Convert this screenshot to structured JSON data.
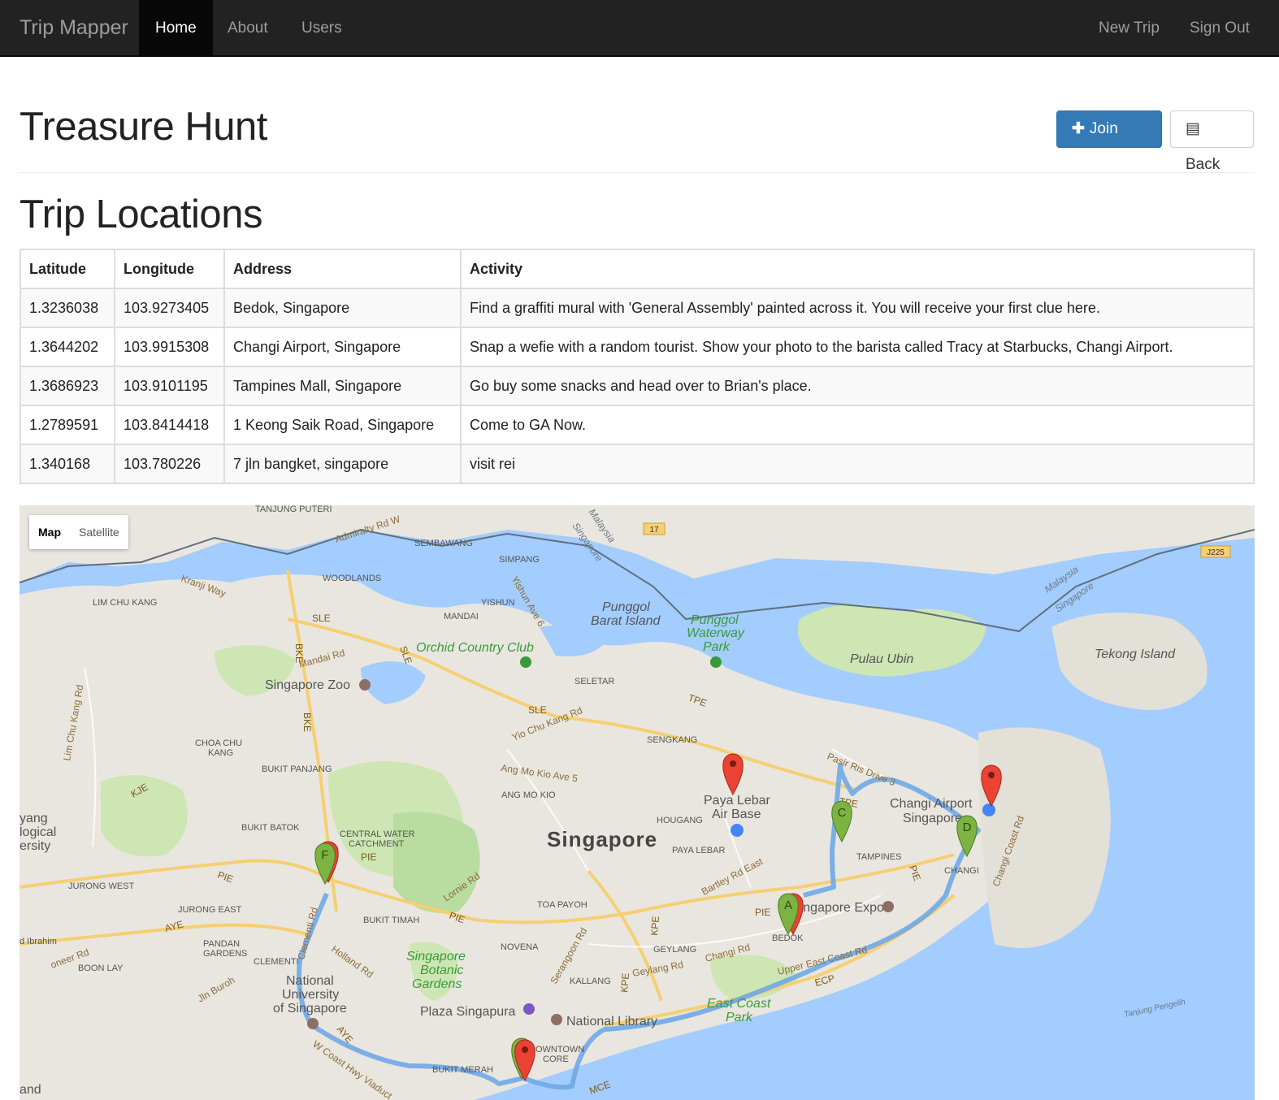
{
  "nav": {
    "brand": "Trip Mapper",
    "items": [
      {
        "label": "Home"
      },
      {
        "label": "About"
      },
      {
        "label": "Users"
      }
    ],
    "right": [
      {
        "label": "New Trip"
      },
      {
        "label": "Sign Out"
      }
    ]
  },
  "page": {
    "title": "Treasure Hunt",
    "join_label": "Join Trip",
    "back_label": "Back",
    "section_title": "Trip Locations"
  },
  "table": {
    "headers": [
      "Latitude",
      "Longitude",
      "Address",
      "Activity"
    ],
    "rows": [
      [
        "1.3236038",
        "103.9273405",
        "Bedok, Singapore",
        "Find a graffiti mural with 'General Assembly' painted across it. You will receive your first clue here."
      ],
      [
        "1.3644202",
        "103.9915308",
        "Changi Airport, Singapore",
        "Snap a wefie with a random tourist. Show your photo to the barista called Tracy at Starbucks, Changi Airport."
      ],
      [
        "1.3686923",
        "103.9101195",
        "Tampines Mall, Singapore",
        "Go buy some snacks and head over to Brian's place."
      ],
      [
        "1.2789591",
        "103.8414418",
        "1 Keong Saik Road, Singapore",
        "Come to GA Now."
      ],
      [
        "1.340168",
        "103.780226",
        "7 jln bangket, singapore",
        "visit rei"
      ]
    ]
  },
  "map": {
    "type_map": "Map",
    "type_satellite": "Satellite",
    "labels": {
      "singapore": "Singapore",
      "punggol_barat": "Punggol",
      "punggol_barat2": "Barat Island",
      "punggol_park": "Punggol",
      "punggol_park2": "Waterway",
      "punggol_park3": "Park",
      "pulau_ubin": "Pulau Ubin",
      "tekong": "Tekong Island",
      "orchid": "Orchid Country Club",
      "zoo": "Singapore Zoo",
      "changi": "Changi Airport",
      "changi2": "Singapore",
      "paya_lebar": "Paya Lebar",
      "paya_lebar2": "Air Base",
      "expo": "Singapore Expo",
      "botanic": "Singapore",
      "botanic2": "Botanic",
      "botanic3": "Gardens",
      "plaza": "Plaza Singapura",
      "library": "National Library",
      "nus": "National",
      "nus2": "University",
      "nus3": "of Singapore",
      "east_coast": "East Coast",
      "east_coast2": "Park",
      "sembawang": "SEMBAWANG",
      "simpang": "SIMPANG",
      "woodlands": "WOODLANDS",
      "yishun": "YISHUN",
      "mandai": "MANDAI",
      "lim_chu_kang": "LIM CHU KANG",
      "seletar": "SELETAR",
      "sengkang": "SENGKANG",
      "ang_mo_kio": "ANG MO KIO",
      "hougang": "HOUGANG",
      "paya_lebar_dist": "PAYA LEBAR",
      "tampines": "TAMPINES",
      "bukit_panjang": "BUKIT PANJANG",
      "bukit_batok": "BUKIT BATOK",
      "choa_chu_kang": "CHOA CHU",
      "choa_chu_kang2": "KANG",
      "central_water": "CENTRAL WATER",
      "central_water2": "CATCHMENT",
      "jurong_west": "JURONG WEST",
      "jurong_east": "JURONG EAST",
      "bukit_timah": "BUKIT TIMAH",
      "toa_payoh": "TOA PAYOH",
      "novena": "NOVENA",
      "geylang": "GEYLANG",
      "kallang": "KALLANG",
      "pandan": "PANDAN",
      "pandan2": "GARDENS",
      "clementi": "CLEMENTI",
      "boon_lay": "BOON LAY",
      "downtown": "DOWNTOWN",
      "downtown2": "CORE",
      "bukit_merah": "BUKIT MERAH",
      "changi_dist": "CHANGI",
      "bedok": "BEDOK",
      "tanjung_puteri": "TANJUNG PUTERI",
      "kranji": "Kranji Way",
      "admiralty": "Admiralty Rd W",
      "mandai_rd": "Mandai Rd",
      "yio_chu_kang": "Yio Chu Kang Rd",
      "lorong": "Lornie Rd",
      "upper_east": "Upper East Coast Rd",
      "geylang_rd": "Geylang Rd",
      "changi_rd": "Changi Rd",
      "holland": "Holland Rd",
      "serangoon": "Serangoon Rd",
      "clementi_rd": "Clementi Rd",
      "jln_buroh": "Jln Buroh",
      "w_coast": "W Coast Hwy Viaduct",
      "changi_coast": "Changi Coast Rd",
      "lim_chu_kang_rd": "Lim Chu Kang Rd",
      "bartley": "Bartley Rd East",
      "pasir_ris": "Pasir Ris Drive 3",
      "ang_mo_kio_ave": "Ang Mo Kio Ave 5",
      "yishun_ave": "Yishun Ave 6",
      "malaysia": "Malaysia",
      "singapore_border": "Singapore",
      "yang": "yang",
      "logical": "logical",
      "ersity": "ersity",
      "d_ibrahim": "d Ibrahim",
      "pioneer": "oneer Rd",
      "and": "and",
      "tanjung_pengelih": "Tanjung Pengelih",
      "sle": "SLE",
      "bke": "BKE",
      "pie": "PIE",
      "aye": "AYE",
      "kje": "KJE",
      "tpe": "TPE",
      "kpe": "KPE",
      "ecp": "ECP",
      "mce": "MCE",
      "r17": "17",
      "j225": "J225"
    },
    "markers": [
      {
        "label": "A",
        "color": "green"
      },
      {
        "label": "C",
        "color": "green"
      },
      {
        "label": "D",
        "color": "green"
      },
      {
        "label": "F",
        "color": "green"
      }
    ],
    "colors": {
      "water": "#a3ccff",
      "land": "#e9e6df",
      "park": "#cde6b4",
      "route": "#6fa8e6",
      "marker_red": "#ea4335",
      "marker_green": "#7cb342",
      "highway": "#f6cf72"
    }
  }
}
